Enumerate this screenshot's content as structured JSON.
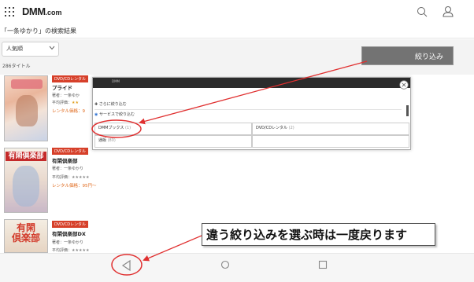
{
  "header": {
    "logo": "DMM",
    "logo_suffix": ".com"
  },
  "search": {
    "query_title": "「一条ゆかり」の検索結果",
    "sort_label": "人気順",
    "result_count": "286タイトル"
  },
  "filter_button_label": "絞り込み",
  "products": [
    {
      "badge": "DVD/CDレンタル",
      "title": "プライド",
      "author": "著者：一条ゆか",
      "rating": "平均評価：",
      "rating_stars": "★★",
      "price": "レンタル価格：9"
    },
    {
      "badge": "DVD/CDレンタル",
      "title": "有閑倶楽部",
      "author": "著者：一条ゆかり",
      "rating": "平均評価：",
      "rating_stars": "★★★★★",
      "price": "レンタル価格：95円～"
    },
    {
      "badge": "DVD/CDレンタル",
      "title": "有閑倶楽部DX",
      "author": "著者：一条ゆかり",
      "rating": "平均評価：",
      "rating_stars": "★★★★★"
    }
  ],
  "dialog": {
    "header_text": "DMM",
    "more_filters": "さらに絞り込む",
    "filter_by_service": "サービスで絞り込む",
    "options": [
      {
        "label": "DMMブックス",
        "count": "(1)"
      },
      {
        "label": "DVD/CDレンタル",
        "count": "(2)"
      },
      {
        "label": "通販",
        "count": "(80)"
      }
    ]
  },
  "callout_text": "違う絞り込みを選ぶ時は一度戻ります",
  "colors": {
    "annotation_red": "#e03030",
    "badge_red": "#d6402a",
    "price_orange": "#e06a1d",
    "filter_button_bg": "#737373"
  },
  "icons": {
    "grid": "grid-icon",
    "search": "search-icon",
    "user": "user-icon",
    "close": "close-icon",
    "back": "back-triangle-icon",
    "home": "home-circle-icon",
    "recent": "recent-square-icon"
  }
}
